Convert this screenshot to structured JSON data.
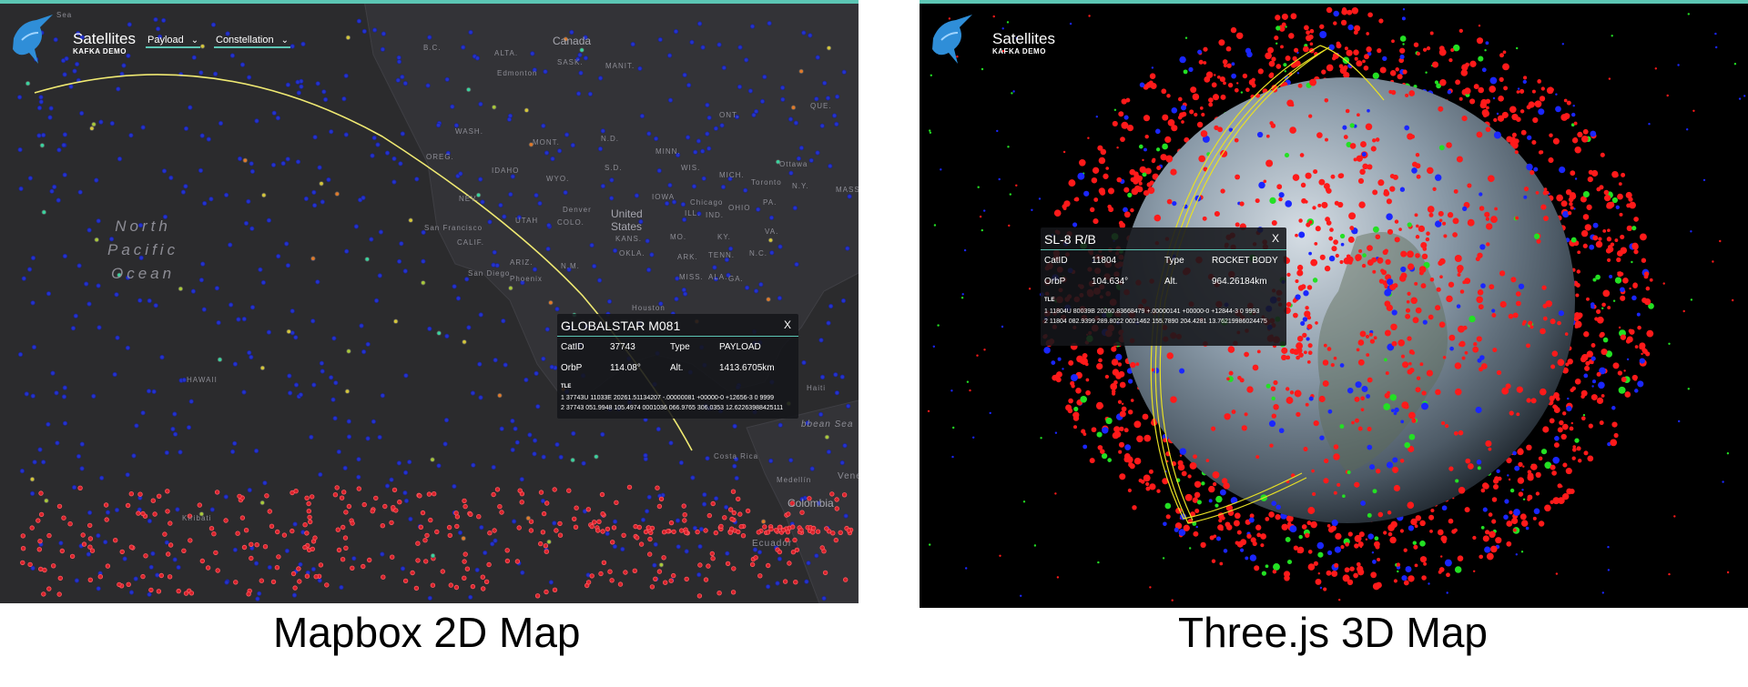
{
  "app": {
    "name": "Satellites",
    "subtitle": "KAFKA DEMO"
  },
  "left": {
    "caption": "Mapbox 2D Map",
    "dropdowns": [
      {
        "label": "Payload"
      },
      {
        "label": "Constellation"
      }
    ],
    "places": {
      "sea": "Sea",
      "canada": "Canada",
      "bc": "B.C.",
      "alta": "ALTA.",
      "sask": "SASK.",
      "manit": "MANIT.",
      "edmonton": "Edmonton",
      "ont": "ONT.",
      "que": "QUE.",
      "wash": "WASH.",
      "mont": "MONT.",
      "nd": "N.D.",
      "minn": "MINN.",
      "oreg": "OREG.",
      "idaho": "IDAHO",
      "wyo": "WYO.",
      "sd": "S.D.",
      "wis": "WIS.",
      "mich": "MICH.",
      "ottawa": "Ottawa",
      "toronto": "Toronto",
      "nev": "NEV.",
      "utah": "UTAH",
      "denver": "Denver",
      "colo": "COLO.",
      "usa": "United States",
      "iowa": "IOWA",
      "chicago": "Chicago",
      "ill": "ILL.",
      "ind": "IND.",
      "ohio": "OHIO",
      "pa": "PA.",
      "ny": "N.Y.",
      "mass": "MASS.",
      "sf": "San Francisco",
      "calif": "CALIF.",
      "kans": "KANS.",
      "mo": "MO.",
      "ky": "KY.",
      "va": "VA.",
      "sandiego": "San Diego",
      "phoenix": "Phoenix",
      "ariz": "ARIZ.",
      "nm": "N.M.",
      "okla": "OKLA.",
      "ark": "ARK.",
      "tenn": "TENN.",
      "nc": "N.C.",
      "miss": "MISS.",
      "ala": "ALA.",
      "ga": "GA.",
      "houston": "Houston",
      "hawaii": "HAWAII",
      "haiti": "Haiti",
      "caribbean": "bbean Sea",
      "costarica": "Costa Rica",
      "medellin": "Medellín",
      "colombia": "Colombia",
      "ecuador": "Ecuador",
      "venezuela": "Vene",
      "kiribati": "Kiribati"
    },
    "ocean_lines": [
      "North",
      "Pacific",
      "Ocean"
    ],
    "popup": {
      "title": "GLOBALSTAR M081",
      "close": "X",
      "catid_label": "CatID",
      "catid": "37743",
      "type_label": "Type",
      "type": "PAYLOAD",
      "orbp_label": "OrbP",
      "orbp": "114.08°",
      "alt_label": "Alt.",
      "alt": "1413.6705km",
      "tle_label": "TLE",
      "tle1": "1 37743U 11033E 20261.51134207 -.00000081 +00000-0 +12656-3 0 9999",
      "tle2": "2 37743 051.9948 105.4974 0001036 066.9765 306.0353 12.62263988425111"
    },
    "colors": {
      "bg": "#2b2b2d",
      "blue": "#2433cc",
      "red": "#d8222c",
      "orbit": "#f0ea72",
      "accent": "#5cc6b4"
    }
  },
  "right": {
    "caption": "Three.js 3D Map",
    "popup": {
      "title": "SL-8 R/B",
      "close": "X",
      "catid_label": "CatID",
      "catid": "11804",
      "type_label": "Type",
      "type": "ROCKET BODY",
      "orbp_label": "OrbP",
      "orbp": "104.634°",
      "alt_label": "Alt.",
      "alt": "964.26184km",
      "tle_label": "TLE",
      "tle1": "1 11804U 80039B 20260.83668479 +.00000141 +00000-0 +12844-3 0 9993",
      "tle2": "2 11804 082.9399 289.8022 0021462 155.7890 204.4281 13.76219986024475"
    },
    "colors": {
      "bg": "#000000",
      "earth": "#7a8a98",
      "red": "#ff1a1a",
      "blue": "#1a26ff",
      "green": "#23e023"
    }
  }
}
